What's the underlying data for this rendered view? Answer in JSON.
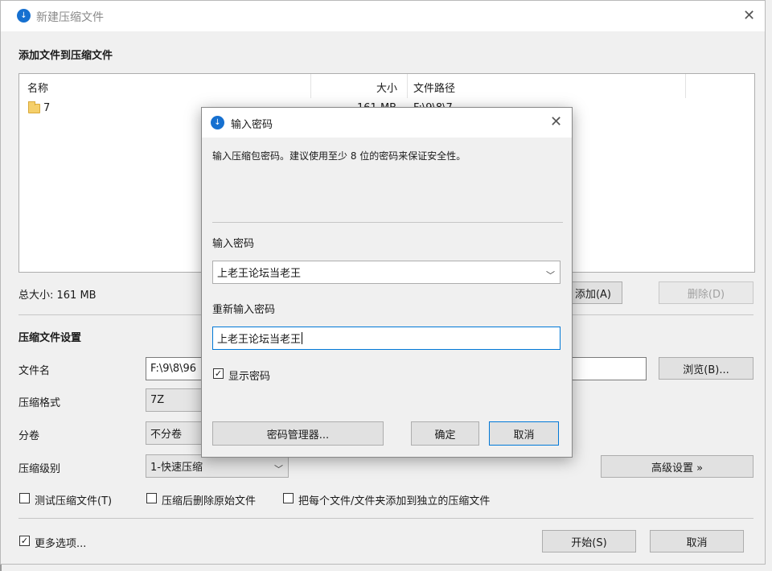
{
  "main_window": {
    "title": "新建压缩文件",
    "add_section_label": "添加文件到压缩文件",
    "columns": {
      "name": "名称",
      "size": "大小",
      "path": "文件路径"
    },
    "files": [
      {
        "name": "7",
        "size": "161 MB",
        "path": "F:\\9\\8\\7"
      }
    ],
    "total_size": "总大小: 161 MB",
    "add_button": "添加(A)",
    "delete_button": "删除(D)",
    "settings_label": "压缩文件设置",
    "filename_label": "文件名",
    "filename_value": "F:\\9\\8\\96",
    "browse_button": "浏览(B)...",
    "format_label": "压缩格式",
    "format_value": "7Z",
    "split_label": "分卷",
    "split_value": "不分卷",
    "level_label": "压缩级别",
    "level_value": "1-快速压缩",
    "advanced_button": "高级设置 »",
    "test_archive_label": "测试压缩文件(T)",
    "delete_original_label": "压缩后删除原始文件",
    "separate_archive_label": "把每个文件/文件夹添加到独立的压缩文件",
    "more_options_label": "更多选项...",
    "start_button": "开始(S)",
    "cancel_button": "取消"
  },
  "dialog": {
    "title": "输入密码",
    "hint": "输入压缩包密码。建议使用至少 8 位的密码来保证安全性。",
    "password_label": "输入密码",
    "password_value": "上老王论坛当老王",
    "confirm_label": "重新输入密码",
    "confirm_value": "上老王论坛当老王",
    "show_password_label": "显示密码",
    "show_password_checked": true,
    "manager_button": "密码管理器...",
    "ok_button": "确定",
    "cancel_button": "取消"
  },
  "icons": {
    "app": "app-logo-icon",
    "folder": "folder-icon",
    "close": "close-icon",
    "dropdown": "chevron-down-icon"
  },
  "colors": {
    "accent": "#0078d7",
    "app_icon": "#1670d0",
    "folder": "#f5cf6a"
  }
}
